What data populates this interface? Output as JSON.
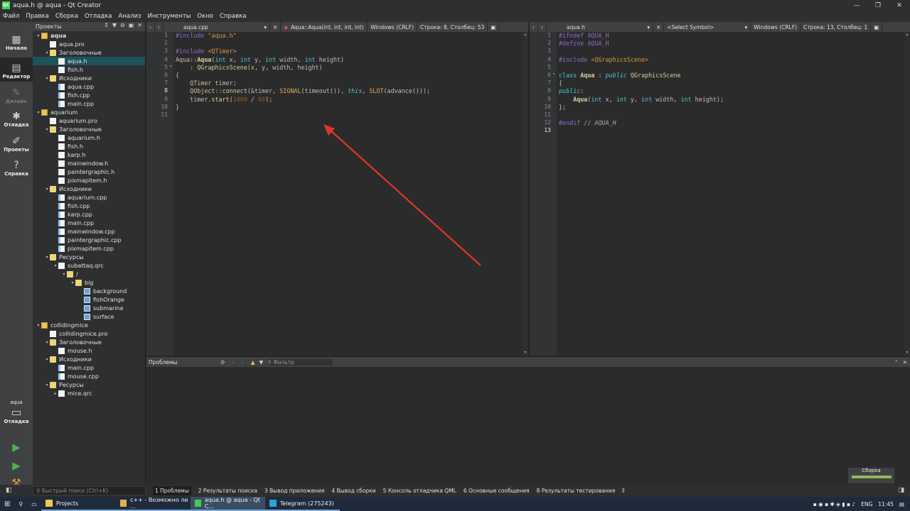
{
  "window": {
    "title": "aqua.h @ aqua - Qt Creator",
    "app_icon": "QC"
  },
  "menu": [
    "Файл",
    "Правка",
    "Сборка",
    "Отладка",
    "Анализ",
    "Инструменты",
    "Окно",
    "Справка"
  ],
  "modes": [
    {
      "label": "Начало",
      "icon": "grid-icon"
    },
    {
      "label": "Редактор",
      "icon": "edit-icon"
    },
    {
      "label": "Дизайн",
      "icon": "pen-icon"
    },
    {
      "label": "Отладка",
      "icon": "bug-icon"
    },
    {
      "label": "Проекты",
      "icon": "wrench-icon"
    },
    {
      "label": "Справка",
      "icon": "help-icon"
    }
  ],
  "kit": {
    "name": "aqua",
    "label": "Отладка"
  },
  "projects_pane": {
    "title": "Проекты",
    "tree": [
      {
        "label": "aqua",
        "level": 0,
        "kind": "proj",
        "arrow": "▾",
        "bold": true
      },
      {
        "label": "aqua.pro",
        "level": 1,
        "kind": "file"
      },
      {
        "label": "Заголовочные",
        "level": 1,
        "kind": "folder",
        "arrow": "▾"
      },
      {
        "label": "aqua.h",
        "level": 2,
        "kind": "file",
        "selected": true
      },
      {
        "label": "fish.h",
        "level": 2,
        "kind": "file"
      },
      {
        "label": "Исходники",
        "level": 1,
        "kind": "folder",
        "arrow": "▾"
      },
      {
        "label": "aqua.cpp",
        "level": 2,
        "kind": "filecpp"
      },
      {
        "label": "fish.cpp",
        "level": 2,
        "kind": "filecpp"
      },
      {
        "label": "main.cpp",
        "level": 2,
        "kind": "filecpp"
      },
      {
        "label": "aquarium",
        "level": 0,
        "kind": "proj",
        "arrow": "▾"
      },
      {
        "label": "aquarium.pro",
        "level": 1,
        "kind": "file"
      },
      {
        "label": "Заголовочные",
        "level": 1,
        "kind": "folder",
        "arrow": "▾"
      },
      {
        "label": "aquarium.h",
        "level": 2,
        "kind": "file"
      },
      {
        "label": "fish.h",
        "level": 2,
        "kind": "file"
      },
      {
        "label": "karp.h",
        "level": 2,
        "kind": "file"
      },
      {
        "label": "mainwindow.h",
        "level": 2,
        "kind": "file"
      },
      {
        "label": "paintergraphic.h",
        "level": 2,
        "kind": "file"
      },
      {
        "label": "pixmapitem.h",
        "level": 2,
        "kind": "file"
      },
      {
        "label": "Исходники",
        "level": 1,
        "kind": "folder",
        "arrow": "▾"
      },
      {
        "label": "aquarium.cpp",
        "level": 2,
        "kind": "filecpp"
      },
      {
        "label": "fish.cpp",
        "level": 2,
        "kind": "filecpp"
      },
      {
        "label": "karp.cpp",
        "level": 2,
        "kind": "filecpp"
      },
      {
        "label": "main.cpp",
        "level": 2,
        "kind": "filecpp"
      },
      {
        "label": "mainwindow.cpp",
        "level": 2,
        "kind": "filecpp"
      },
      {
        "label": "paintergraphic.cpp",
        "level": 2,
        "kind": "filecpp"
      },
      {
        "label": "pixmapitem.cpp",
        "level": 2,
        "kind": "filecpp"
      },
      {
        "label": "Ресурсы",
        "level": 1,
        "kind": "folder",
        "arrow": "▾"
      },
      {
        "label": "subattaq.qrc",
        "level": 2,
        "kind": "file",
        "arrow": "▾"
      },
      {
        "label": "/",
        "level": 3,
        "kind": "folder",
        "arrow": "▾"
      },
      {
        "label": "big",
        "level": 4,
        "kind": "folder",
        "arrow": "▾"
      },
      {
        "label": "background",
        "level": 5,
        "kind": "img"
      },
      {
        "label": "fishOrange",
        "level": 5,
        "kind": "img"
      },
      {
        "label": "submarine",
        "level": 5,
        "kind": "img"
      },
      {
        "label": "surface",
        "level": 5,
        "kind": "img"
      },
      {
        "label": "collidingmice",
        "level": 0,
        "kind": "proj",
        "arrow": "▾"
      },
      {
        "label": "collidingmice.pro",
        "level": 1,
        "kind": "file"
      },
      {
        "label": "Заголовочные",
        "level": 1,
        "kind": "folder",
        "arrow": "▾"
      },
      {
        "label": "mouse.h",
        "level": 2,
        "kind": "file"
      },
      {
        "label": "Исходники",
        "level": 1,
        "kind": "folder",
        "arrow": "▾"
      },
      {
        "label": "main.cpp",
        "level": 2,
        "kind": "filecpp"
      },
      {
        "label": "mouse.cpp",
        "level": 2,
        "kind": "filecpp"
      },
      {
        "label": "Ресурсы",
        "level": 1,
        "kind": "folder",
        "arrow": "▾"
      },
      {
        "label": "mice.qrc",
        "level": 2,
        "kind": "file",
        "arrow": "▸"
      }
    ]
  },
  "editor_left": {
    "file": "aqua.cpp",
    "symbol": "Aqua::Aqua(int, int, int, int)",
    "encoding": "Windows (CRLF)",
    "position": "Строка: 8, Столбец: 53",
    "current_line": 8,
    "lines": [
      [
        [
          "pp",
          "#include "
        ],
        [
          "str",
          "\"aqua.h\""
        ]
      ],
      [],
      [
        [
          "pp",
          "#include "
        ],
        [
          "str",
          "<QTimer>"
        ]
      ],
      [
        [
          "ty",
          "Aqua"
        ],
        [
          "",
          "::"
        ],
        [
          "bold",
          "Aqua"
        ],
        [
          "",
          "("
        ],
        [
          "kw2",
          "int"
        ],
        [
          "",
          " x, "
        ],
        [
          "kw2",
          "int"
        ],
        [
          "",
          " y, "
        ],
        [
          "kw2",
          "int"
        ],
        [
          "",
          " width, "
        ],
        [
          "kw2",
          "int"
        ],
        [
          "",
          " height)"
        ]
      ],
      [
        [
          "",
          "    : "
        ],
        [
          "fn",
          "QGraphicsScene"
        ],
        [
          "",
          "(x, y, width, height)"
        ]
      ],
      [
        [
          "",
          "{"
        ]
      ],
      [
        [
          "",
          "    "
        ],
        [
          "ty",
          "QTimer"
        ],
        [
          "",
          " timer;"
        ]
      ],
      [
        [
          "",
          "    "
        ],
        [
          "ty",
          "QObject"
        ],
        [
          "",
          "::"
        ],
        [
          "fn",
          "connect"
        ],
        [
          "",
          "(&timer, "
        ],
        [
          "hl",
          "SIGNAL"
        ],
        [
          "",
          "(timeout()), "
        ],
        [
          "kw",
          "this"
        ],
        [
          "",
          ", "
        ],
        [
          "hl",
          "SLOT"
        ],
        [
          "",
          "(advance()));"
        ]
      ],
      [
        [
          "",
          "    timer."
        ],
        [
          "fn",
          "start"
        ],
        [
          "",
          "("
        ],
        [
          "num",
          "1000"
        ],
        [
          "",
          " / "
        ],
        [
          "num",
          "60"
        ],
        [
          "",
          ");"
        ]
      ],
      [
        [
          "",
          "}"
        ]
      ],
      []
    ]
  },
  "editor_right": {
    "file": "aqua.h",
    "symbol": "<Select Symbol>",
    "encoding": "Windows (CRLF)",
    "position": "Строка: 13, Столбец: 1",
    "current_line": 13,
    "lines": [
      [
        [
          "pp",
          "#ifndef AQUA_H"
        ]
      ],
      [
        [
          "pp",
          "#define AQUA_H"
        ]
      ],
      [],
      [
        [
          "pp",
          "#include "
        ],
        [
          "str",
          "<QGraphicsScene>"
        ]
      ],
      [],
      [
        [
          "kw2",
          "class "
        ],
        [
          "bold",
          "Aqua"
        ],
        [
          "",
          " : "
        ],
        [
          "kw",
          "public "
        ],
        [
          "fn",
          "QGraphicsScene"
        ]
      ],
      [
        [
          "",
          "{"
        ]
      ],
      [
        [
          "kw",
          "public"
        ],
        [
          "",
          ":"
        ]
      ],
      [
        [
          "",
          "    "
        ],
        [
          "bold",
          "Aqua"
        ],
        [
          "",
          "("
        ],
        [
          "kw2",
          "int"
        ],
        [
          "",
          " x, "
        ],
        [
          "kw2",
          "int"
        ],
        [
          "",
          " y, "
        ],
        [
          "kw2",
          "int"
        ],
        [
          "",
          " width, "
        ],
        [
          "kw2",
          "int"
        ],
        [
          "",
          " height);"
        ]
      ],
      [
        [
          "",
          "};"
        ]
      ],
      [],
      [
        [
          "pp",
          "#endif "
        ],
        [
          "cmt",
          "// AQUA_H"
        ]
      ],
      []
    ]
  },
  "output_pane": {
    "title": "Проблемы",
    "filter_placeholder": "Фильтр"
  },
  "status": {
    "locator_placeholder": "Быстрый поиск (Ctrl+K)",
    "tabs": [
      "1 Проблемы",
      "2 Результаты поиска",
      "3 Вывод приложения",
      "4 Вывод сборки",
      "5 Консоль отладчика QML",
      "6 Основные сообщения",
      "8 Результаты тестирования"
    ]
  },
  "build_progress": {
    "label": "Сборка",
    "progress": 1.0
  },
  "taskbar": {
    "apps": [
      {
        "label": "Projects",
        "color": "#f2c94c"
      },
      {
        "label": "c++ - Возможно ли ...",
        "color": "#e0b24a"
      },
      {
        "label": "aqua.h @ aqua - Qt C...",
        "color": "#41cd52",
        "active": true
      },
      {
        "label": "Telegram (275243)",
        "color": "#2ea0dc"
      }
    ],
    "lang": "ENG",
    "time": "11:45"
  },
  "colors": {
    "accent_selection": "#1d545c",
    "annotation_arrow": "#e0352b"
  }
}
